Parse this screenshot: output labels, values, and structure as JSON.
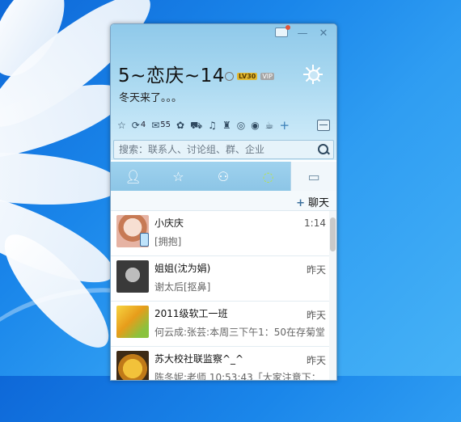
{
  "window": {
    "profile": {
      "nickname": "5~恋庆~14",
      "level_badge": "LV30",
      "vip_badge": "VIP",
      "signature": "冬天来了。。。"
    },
    "apps": [
      {
        "icon": "star-icon",
        "count": ""
      },
      {
        "icon": "qzone-icon",
        "count": "4"
      },
      {
        "icon": "mail-icon",
        "count": "55"
      },
      {
        "icon": "pet-icon",
        "count": ""
      },
      {
        "icon": "cart-icon",
        "count": ""
      },
      {
        "icon": "music-icon",
        "count": ""
      },
      {
        "icon": "bag-icon",
        "count": ""
      },
      {
        "icon": "game-icon",
        "count": ""
      },
      {
        "icon": "buddy-icon",
        "count": ""
      },
      {
        "icon": "coffee-icon",
        "count": ""
      },
      {
        "icon": "add-icon",
        "count": ""
      }
    ],
    "search": {
      "placeholder": "搜索：联系人、讨论组、群、企业"
    },
    "tabs": [
      {
        "name": "contacts-tab",
        "icon": "person-icon"
      },
      {
        "name": "favorites-tab",
        "icon": "star-icon"
      },
      {
        "name": "groups-tab",
        "icon": "group-icon"
      },
      {
        "name": "qzone-tab",
        "icon": "qzone-icon"
      },
      {
        "name": "sessions-tab",
        "icon": "chat-bubble-icon"
      }
    ],
    "chat_button": "聊天",
    "sessions": [
      {
        "name": "小庆庆",
        "message": "[拥抱]",
        "time": "1:14"
      },
      {
        "name": "姐姐(沈为娟)",
        "message": "谢太后[抠鼻]",
        "time": "昨天"
      },
      {
        "name": "2011级软工一班",
        "message": "何云成:张芸:本周三下午1：50在存菊堂",
        "time": "昨天"
      },
      {
        "name": "苏大校社联监察^_^",
        "message": "陈冬妮:老师 10:53:43「大家注意下：",
        "time": "昨天"
      }
    ]
  },
  "colors": {
    "desktop": "#1a86ea",
    "header": "#a9d8f0",
    "tabbar": "#8cc5e6"
  }
}
